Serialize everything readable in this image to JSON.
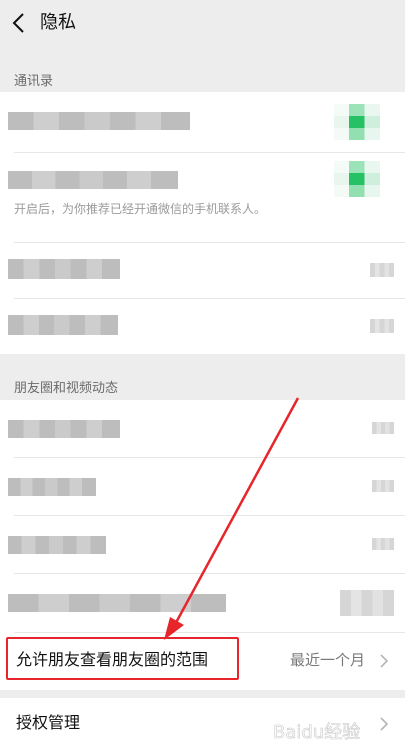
{
  "header": {
    "title": "隐私"
  },
  "sections": {
    "contacts_label": "通讯录",
    "contacts_hint": "开启后，为你推荐已经开通微信的手机联系人。",
    "moments_label": "朋友圈和视频动态"
  },
  "moments_range": {
    "label": "允许朋友查看朋友圈的范围",
    "value": "最近一个月"
  },
  "auth": {
    "label": "授权管理"
  },
  "watermark": {
    "text": "Baidu经验"
  },
  "colors": {
    "accent_green": "#07c160",
    "highlight_red": "#e6262b"
  }
}
